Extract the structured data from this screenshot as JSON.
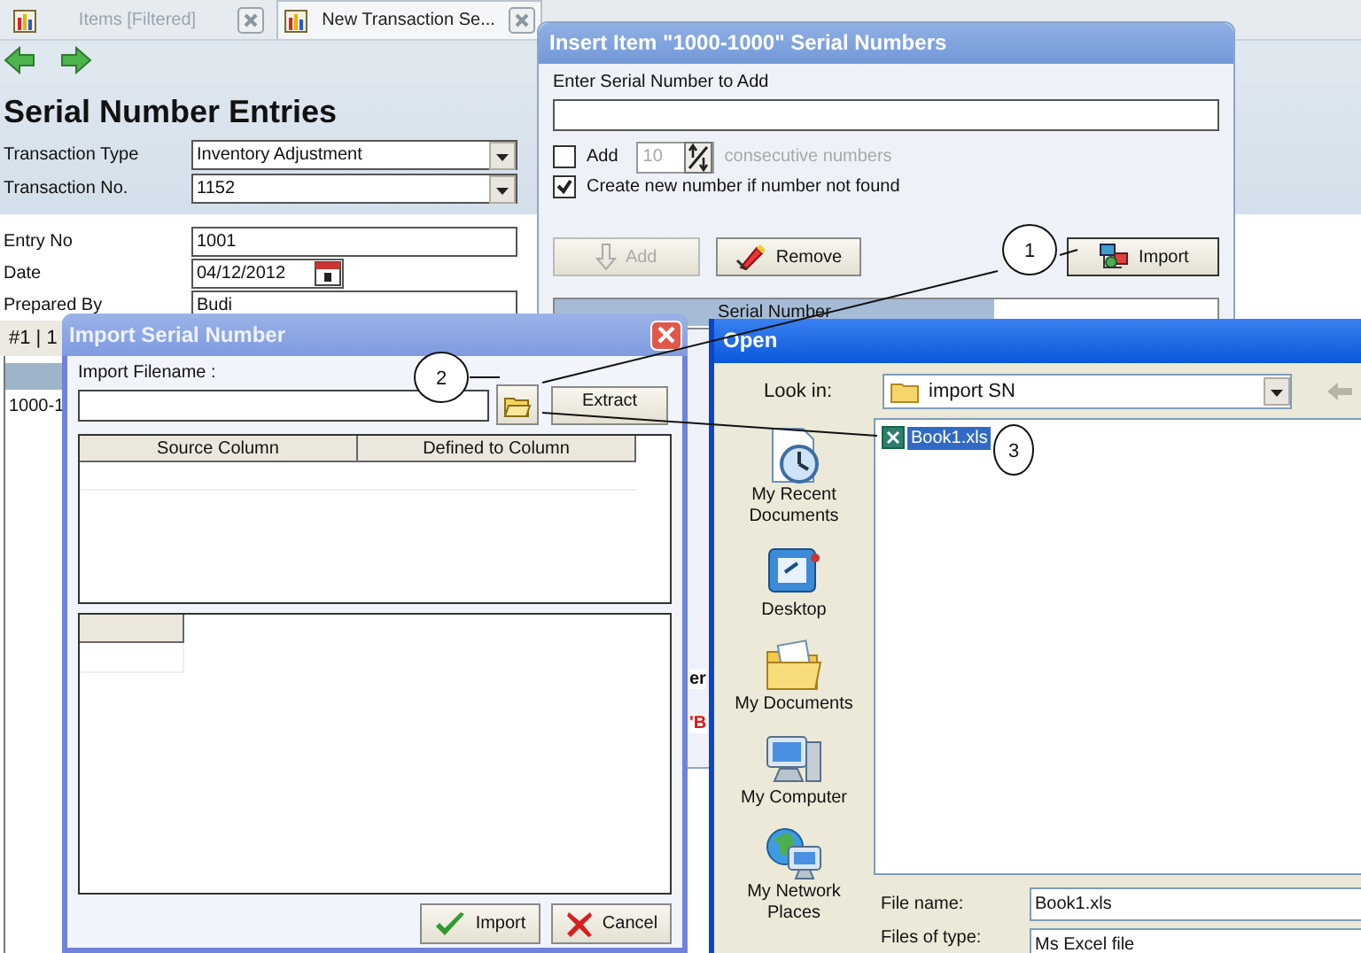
{
  "main": {
    "tabs": [
      {
        "label": "Items [Filtered]",
        "selected": false
      },
      {
        "label": "New Transaction Se...",
        "selected": true
      }
    ],
    "title": "Serial Number Entries",
    "header_fields": [
      {
        "label": "Transaction Type",
        "value": "Inventory Adjustment",
        "kind": "dropdown"
      },
      {
        "label": "Transaction No.",
        "value": "1152",
        "kind": "dropdown"
      }
    ],
    "fields": [
      {
        "label": "Entry No",
        "value": "1001",
        "kind": "text"
      },
      {
        "label": "Date",
        "value": "04/12/2012",
        "kind": "date"
      },
      {
        "label": "Prepared By",
        "value": "Budi",
        "kind": "text"
      }
    ],
    "page_indicator": "#1 | 1",
    "grid_cell": "1000-1"
  },
  "insert_dialog": {
    "title": "Insert Item \"1000-1000\" Serial Numbers",
    "input_label": "Enter Serial Number to Add",
    "add_option": {
      "checked": false,
      "label": "Add",
      "count": "10",
      "suffix": "consecutive numbers"
    },
    "create_option": {
      "checked": true,
      "label": "Create new number if number not found"
    },
    "buttons": [
      {
        "label": "Add",
        "kind": "add",
        "disabled": true
      },
      {
        "label": "Remove",
        "kind": "remove",
        "disabled": false
      },
      {
        "label": "Import",
        "kind": "import",
        "disabled": false
      }
    ],
    "grid_column": "Serial Number",
    "fragments": [
      {
        "text": "er",
        "kind": "plain"
      },
      {
        "text": "'B",
        "kind": "alert"
      }
    ]
  },
  "import_dialog": {
    "title": "Import Serial Number",
    "filename_label": "Import Filename :",
    "extract_button": "Extract",
    "mapping_columns": [
      "Source Column",
      "Defined to Column"
    ],
    "buttons": [
      {
        "label": "Import",
        "kind": "ok"
      },
      {
        "label": "Cancel",
        "kind": "cancel"
      }
    ]
  },
  "open_dialog": {
    "title": "Open",
    "look_in_label": "Look in:",
    "look_in": "import SN",
    "places": [
      {
        "label": "My Recent Documents",
        "kind": "recent"
      },
      {
        "label": "Desktop",
        "kind": "desktop"
      },
      {
        "label": "My Documents",
        "kind": "documents"
      },
      {
        "label": "My Computer",
        "kind": "computer"
      },
      {
        "label": "My Network Places",
        "kind": "network"
      }
    ],
    "files": [
      {
        "name": "Book1.xls",
        "selected": true
      }
    ],
    "file_name_label": "File name:",
    "file_name": "Book1.xls",
    "file_type_label": "Files of type:",
    "file_type": "Ms Excel file"
  },
  "annotations": [
    {
      "number": "1"
    },
    {
      "number": "2"
    },
    {
      "number": "3"
    }
  ]
}
